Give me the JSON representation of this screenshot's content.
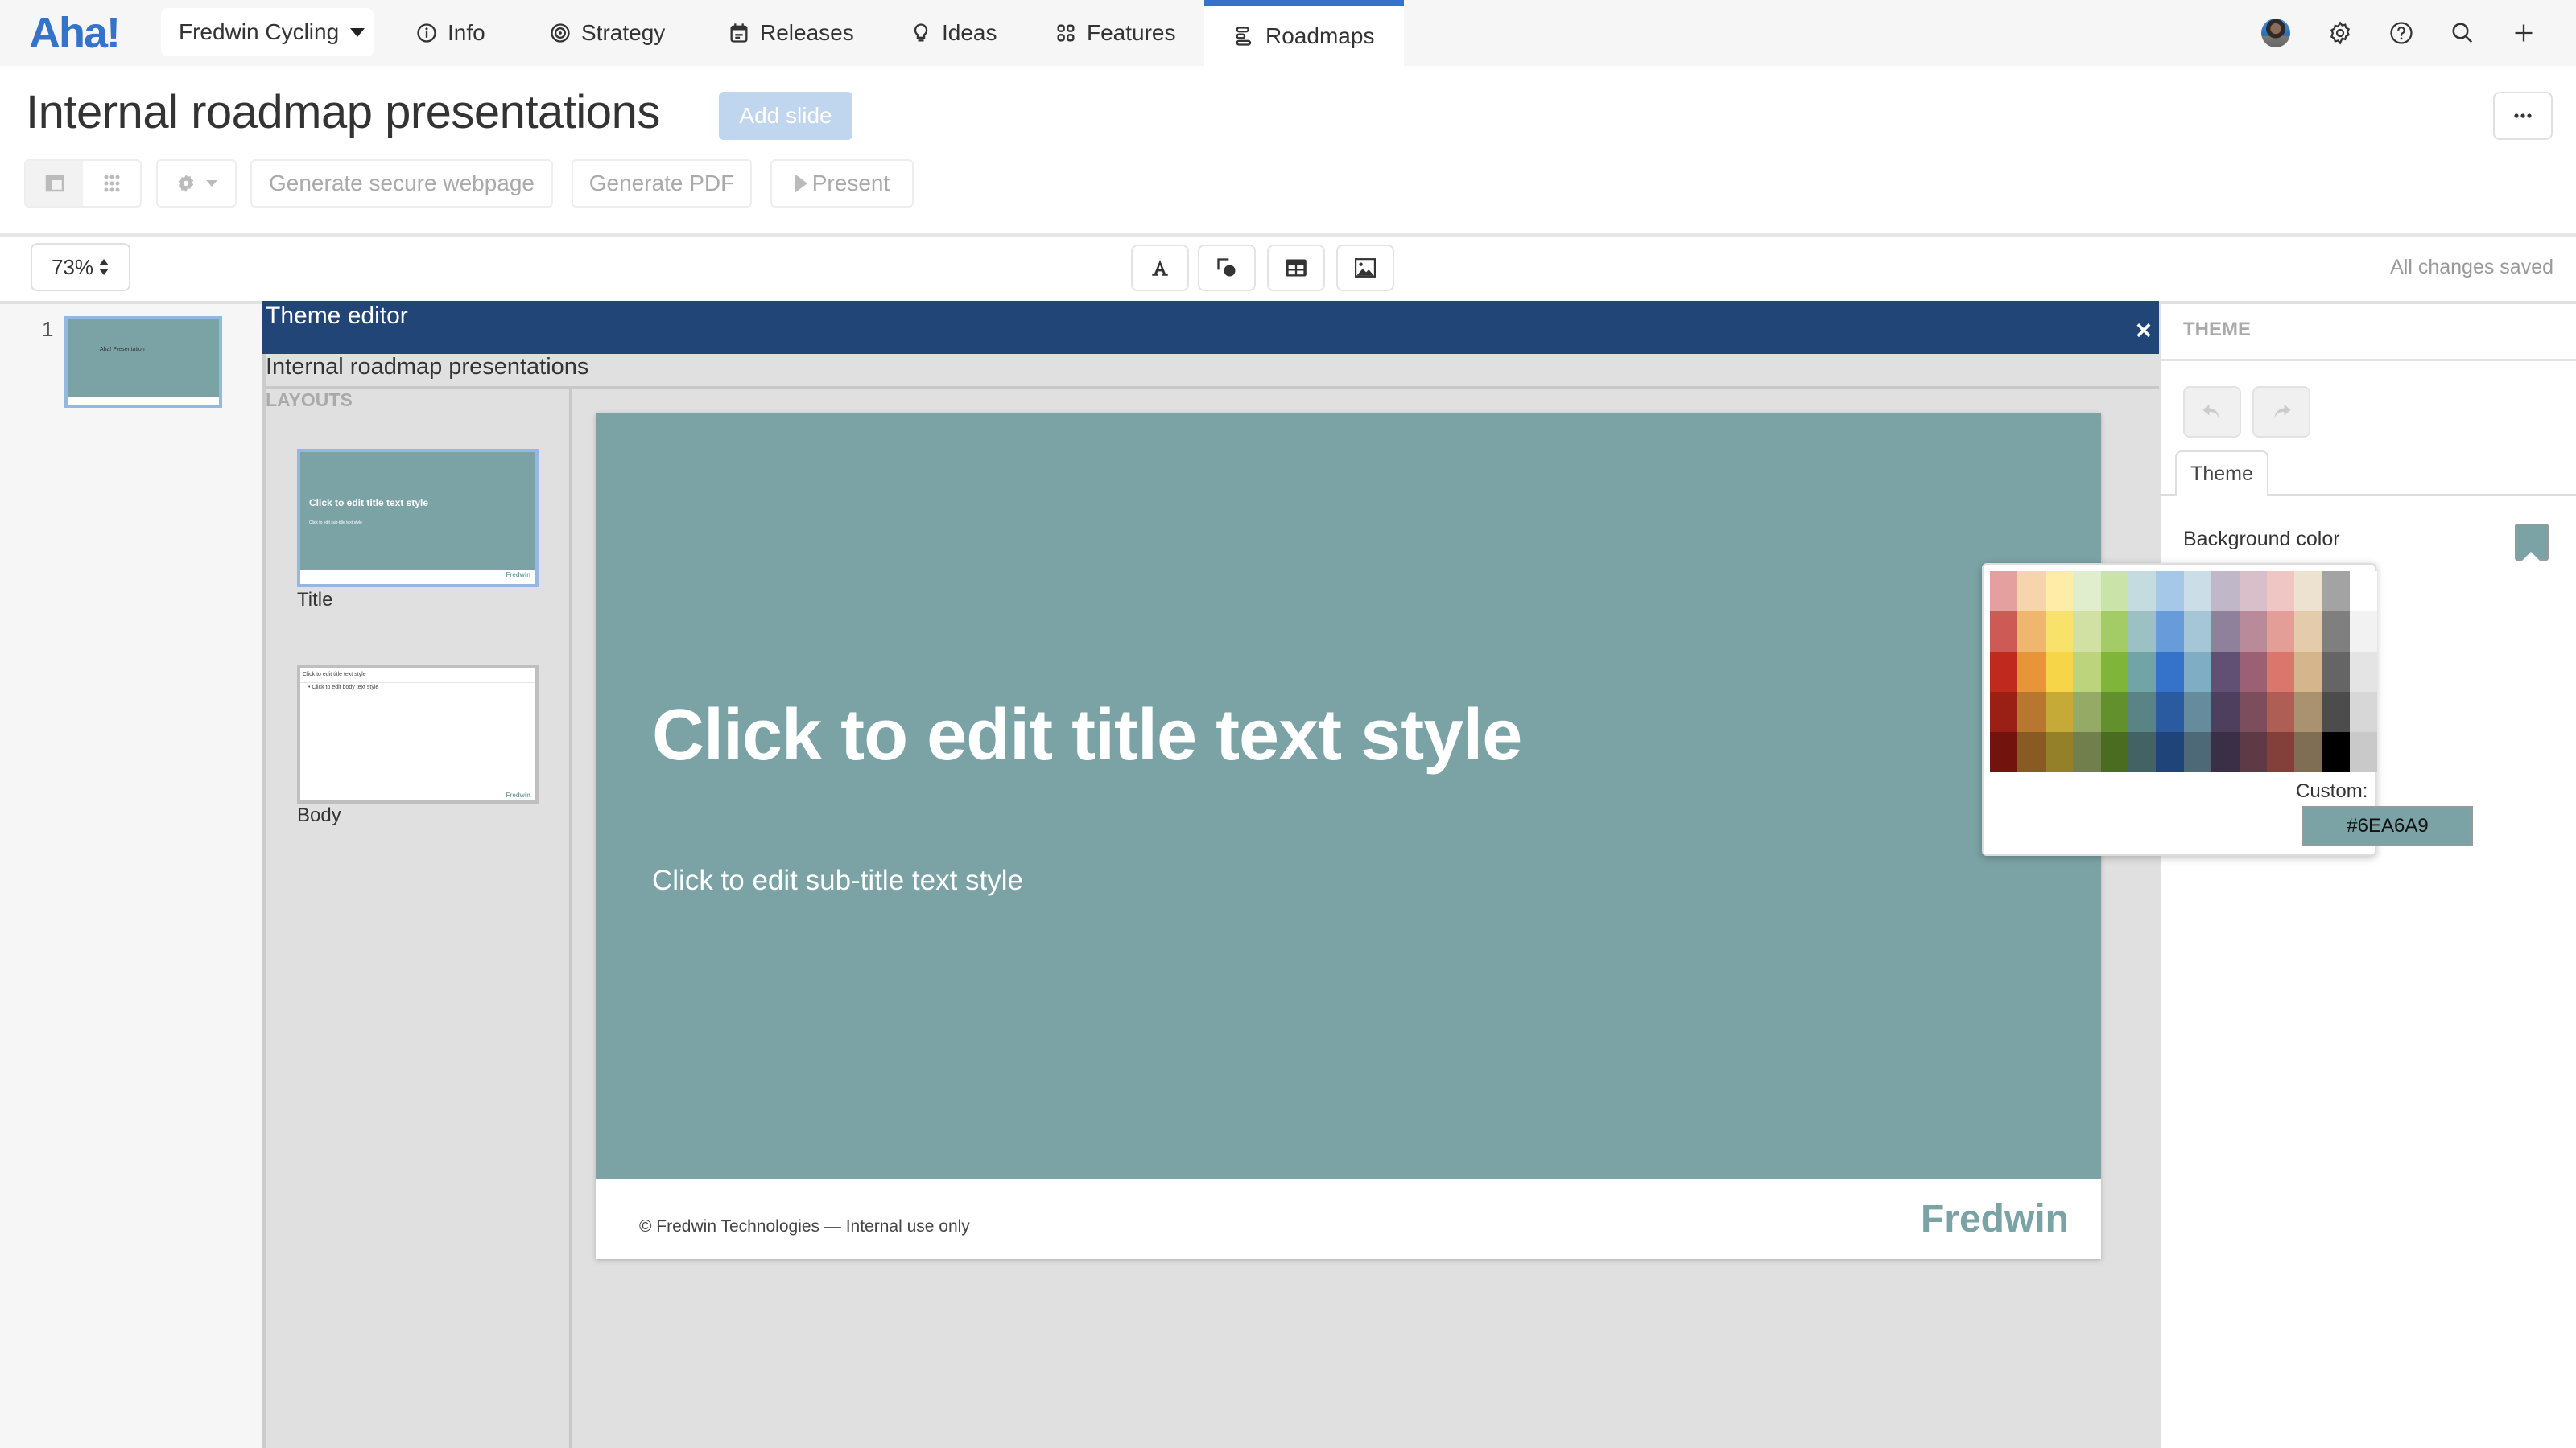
{
  "app": {
    "logo": "Aha!",
    "workspace": "Fredwin Cycling",
    "nav_tabs": [
      {
        "label": "Info",
        "icon": "info-icon"
      },
      {
        "label": "Strategy",
        "icon": "target-icon"
      },
      {
        "label": "Releases",
        "icon": "calendar-icon"
      },
      {
        "label": "Ideas",
        "icon": "lightbulb-icon"
      },
      {
        "label": "Features",
        "icon": "grid-icon"
      },
      {
        "label": "Roadmaps",
        "icon": "roadmap-icon",
        "active": true
      }
    ],
    "top_icons": [
      "avatar",
      "gear-icon",
      "help-icon",
      "search-icon",
      "plus-icon"
    ]
  },
  "page": {
    "title": "Internal roadmap presentations",
    "add_slide": "Add slide",
    "more": "•••",
    "toolbar": {
      "generate_webpage": "Generate secure webpage",
      "generate_pdf": "Generate PDF",
      "present": "Present"
    },
    "zoom": "73%",
    "status": "All changes saved"
  },
  "slides": [
    {
      "number": "1",
      "thumb_title": "Aha! Presentation"
    }
  ],
  "theme_editor": {
    "header": "Theme editor",
    "close": "×",
    "name": "Internal roadmap presentations",
    "layouts_label": "LAYOUTS",
    "layouts": [
      {
        "name": "Title",
        "title": "Click to edit title text style",
        "subtitle": "Click to edit sub-title text style",
        "selected": true
      },
      {
        "name": "Body",
        "title": "Click to edit title text style",
        "body": "Click to edit body text style",
        "selected": false
      }
    ],
    "slide": {
      "title": "Click to edit title text style",
      "subtitle": "Click to edit sub-title text style",
      "footer_text": "© Fredwin Technologies — Internal use only",
      "footer_brand": "Fredwin",
      "background": "#7BA3A6"
    }
  },
  "theme_panel": {
    "title": "THEME",
    "tab": "Theme",
    "background_label": "Background color",
    "picker": {
      "custom_label": "Custom:",
      "custom_value": "#6EA6A9",
      "palette": [
        [
          "#e3a09f",
          "#f6d5ac",
          "#ffeca6",
          "#e1eecd",
          "#cae3a8",
          "#c4dcdf",
          "#a5c7e8",
          "#cbdde7",
          "#c0b8c9",
          "#d8bfc9",
          "#efc6c4",
          "#ede2cf",
          "#a3a3a3",
          "#ffffff"
        ],
        [
          "#cd5a54",
          "#efb66d",
          "#f8e26a",
          "#d0e1a3",
          "#a3cb66",
          "#9bc1c5",
          "#679bda",
          "#a5c6d7",
          "#8f819b",
          "#b98b9a",
          "#e39e98",
          "#e3cbab",
          "#7f7f7f",
          "#f2f2f2"
        ],
        [
          "#c0291e",
          "#e8953a",
          "#f6d648",
          "#bcd57c",
          "#7fb538",
          "#70a4a7",
          "#3572c9",
          "#7fadc4",
          "#614f74",
          "#9c6074",
          "#db766c",
          "#d5b58c",
          "#656565",
          "#e4e4e4"
        ],
        [
          "#9a1f15",
          "#b8772f",
          "#c5aa37",
          "#95aa64",
          "#61902c",
          "#5a8386",
          "#2a5ba1",
          "#668b9d",
          "#4d3f5d",
          "#7c4d5d",
          "#af5e56",
          "#aa9170",
          "#4c4c4c",
          "#d7d7d7"
        ],
        [
          "#73130d",
          "#8a5a23",
          "#938029",
          "#707f4b",
          "#496c21",
          "#436264",
          "#1f4479",
          "#4d6876",
          "#3a2f46",
          "#5d3a46",
          "#833f3a",
          "#7f6d54",
          "#000000",
          "#c9c9c9"
        ]
      ]
    }
  }
}
